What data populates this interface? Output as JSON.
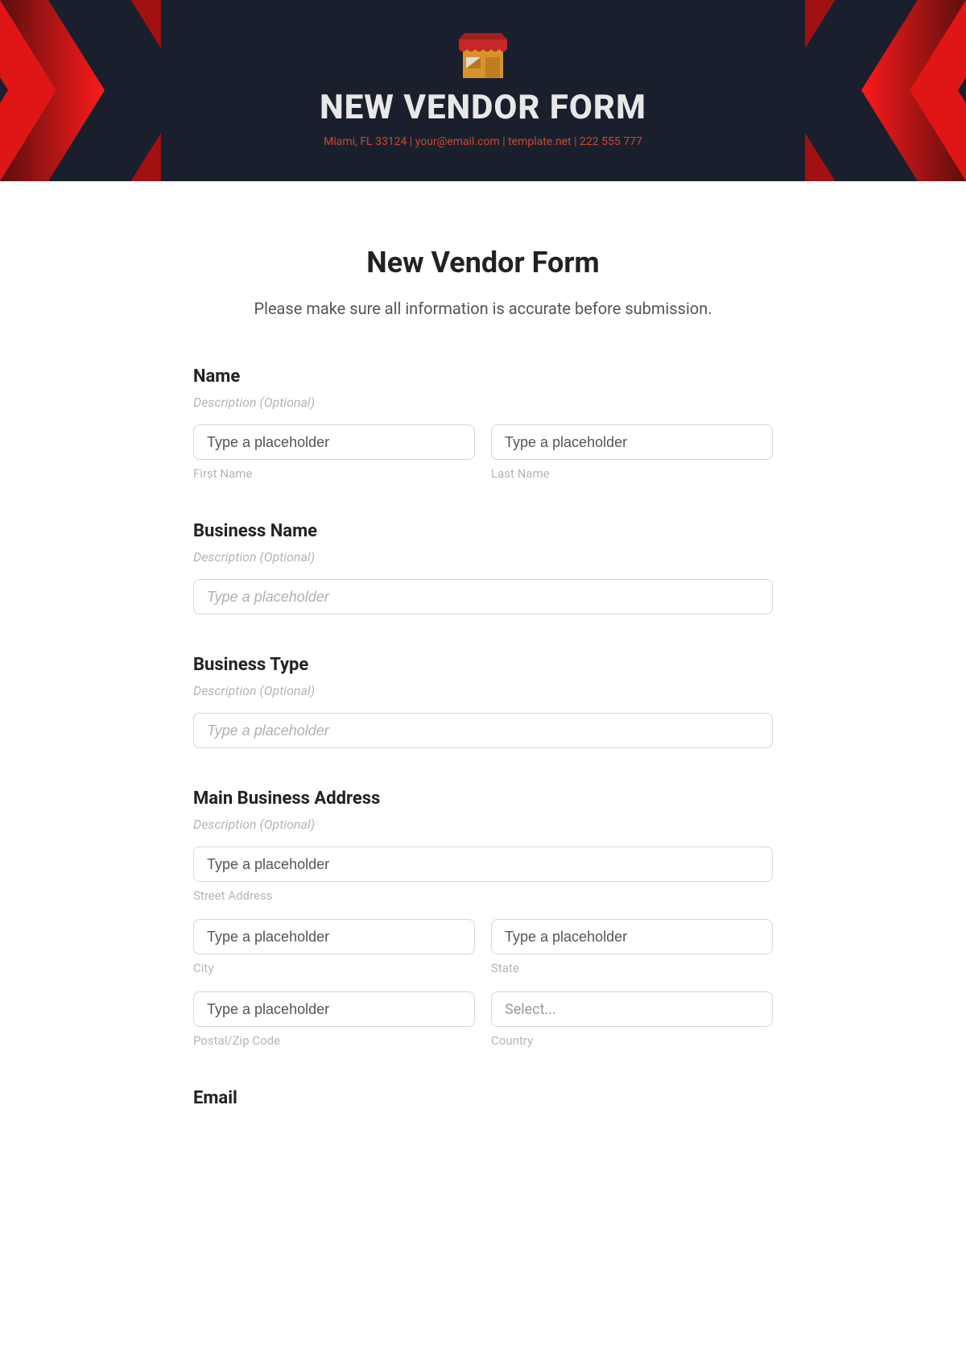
{
  "banner": {
    "title": "NEW VENDOR FORM",
    "subtitle": "Miami, FL 33124 | your@email.com | template.net | 222 555 777"
  },
  "page": {
    "title": "New Vendor Form",
    "description": "Please make sure all information is accurate before submission."
  },
  "common": {
    "desc_optional": "Description (Optional)",
    "placeholder_typed": "Type a placeholder",
    "placeholder_italic": "Type a placeholder",
    "select_placeholder": "Select..."
  },
  "fields": {
    "name": {
      "label": "Name",
      "first_sub": "First Name",
      "last_sub": "Last Name"
    },
    "business_name": {
      "label": "Business Name"
    },
    "business_type": {
      "label": "Business Type"
    },
    "address": {
      "label": "Main Business Address",
      "street_sub": "Street Address",
      "city_sub": "City",
      "state_sub": "State",
      "postal_sub": "Postal/Zip Code",
      "country_sub": "Country"
    },
    "email": {
      "label": "Email"
    }
  }
}
